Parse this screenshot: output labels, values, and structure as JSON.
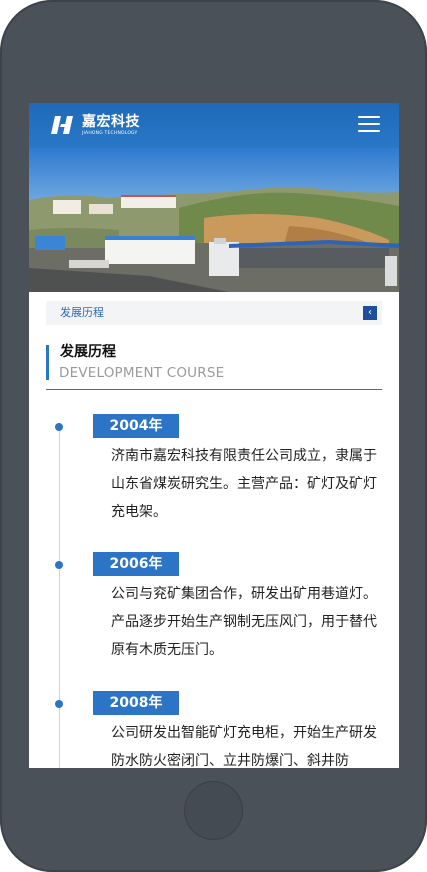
{
  "header": {
    "logo_name": "嘉宏科技",
    "logo_sub": "JIAHONG TECHNOLOGY"
  },
  "breadcrumb": {
    "label": "发展历程",
    "back_icon": "‹"
  },
  "section": {
    "title": "发展历程",
    "subtitle": "DEVELOPMENT COURSE"
  },
  "timeline": [
    {
      "year": "2004年",
      "text": "济南市嘉宏科技有限责任公司成立，隶属于山东省煤炭研究生。主营产品：矿灯及矿灯充电架。"
    },
    {
      "year": "2006年",
      "text": "公司与兖矿集团合作，研发出矿用巷道灯。产品逐步开始生产钢制无压风门，用于替代原有木质无压门。"
    },
    {
      "year": "2008年",
      "text": "公司研发出智能矿灯充电柜，开始生产研发防水防火密闭门、立井防爆门、斜井防"
    }
  ],
  "colors": {
    "accent": "#2b74c6",
    "header": "#1f69b8",
    "phone_frame": "#4a5159"
  },
  "icons": [
    "logo-mark-icon",
    "menu-icon",
    "chevron-left-icon"
  ]
}
